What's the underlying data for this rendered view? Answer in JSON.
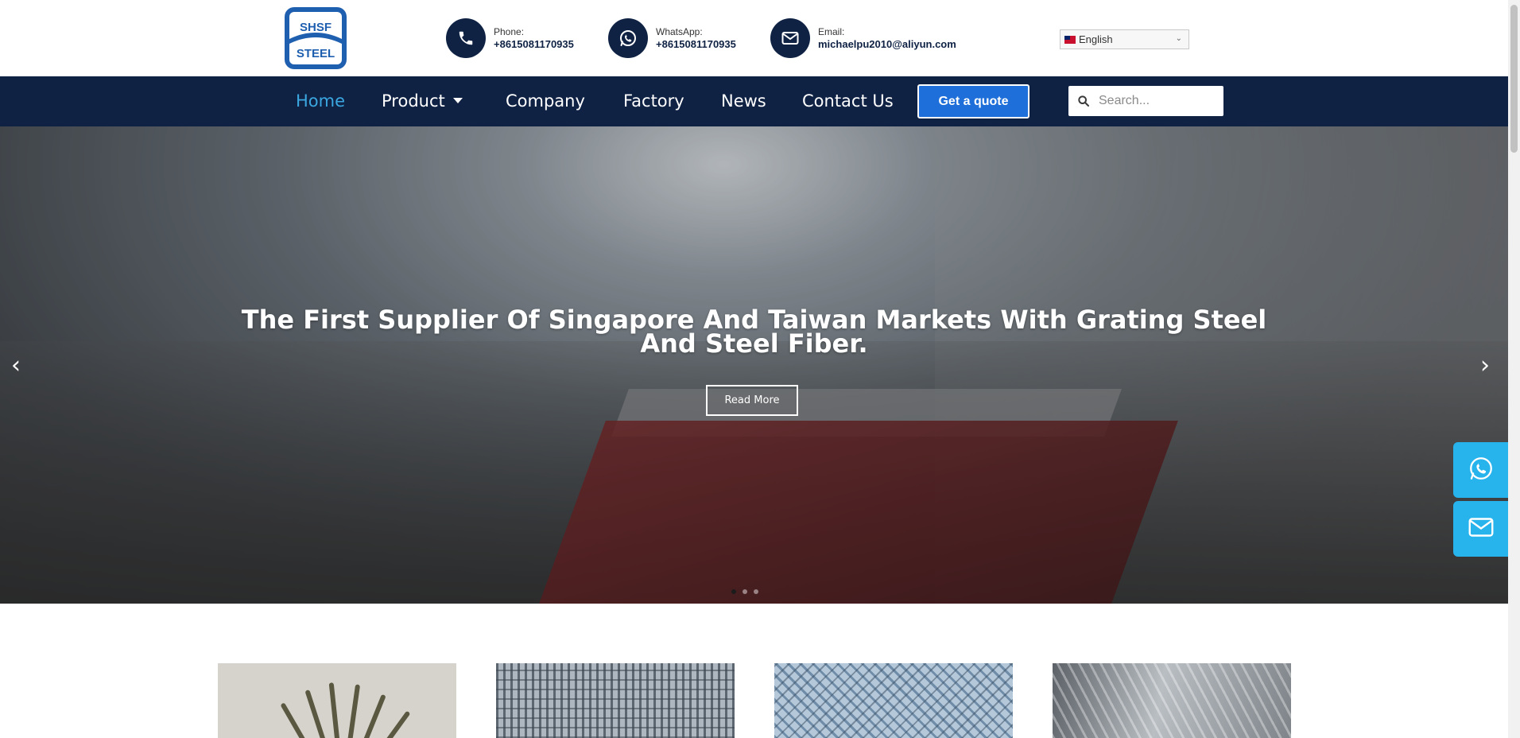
{
  "header": {
    "logo": {
      "line1": "SHSF",
      "line2": "STEEL"
    },
    "contacts": [
      {
        "label": "Phone:",
        "value": "+8615081170935",
        "icon": "phone-icon"
      },
      {
        "label": "WhatsApp:",
        "value": "+8615081170935",
        "icon": "whatsapp-icon"
      },
      {
        "label": "Email:",
        "value": "michaelpu2010@aliyun.com",
        "icon": "mail-icon"
      }
    ],
    "language": "English"
  },
  "nav": {
    "items": [
      {
        "label": "Home",
        "active": true
      },
      {
        "label": "Product",
        "has_dropdown": true
      },
      {
        "label": "Company"
      },
      {
        "label": "Factory"
      },
      {
        "label": "News"
      },
      {
        "label": "Contact Us"
      }
    ],
    "quote_button": "Get a quote",
    "search_placeholder": "Search..."
  },
  "hero": {
    "title_line1": "The First Supplier Of Singapore And Taiwan Markets With Grating Steel",
    "title_line2": "And Steel Fiber.",
    "button": "Read More",
    "prev_arrow": "‹",
    "next_arrow": "›",
    "slide_count": 3,
    "active_slide": 1
  },
  "floating": [
    {
      "icon": "whatsapp-icon"
    },
    {
      "icon": "mail-icon"
    }
  ],
  "products": [
    {
      "image": "steel-fiber"
    },
    {
      "image": "steel-grating"
    },
    {
      "image": "expanded-metal-mesh"
    },
    {
      "image": "steel-tubes"
    }
  ],
  "colors": {
    "nav_bg": "#0f2244",
    "accent": "#3ba7e0",
    "quote_button": "#1e6fd9",
    "float_button": "#27b3ec"
  }
}
